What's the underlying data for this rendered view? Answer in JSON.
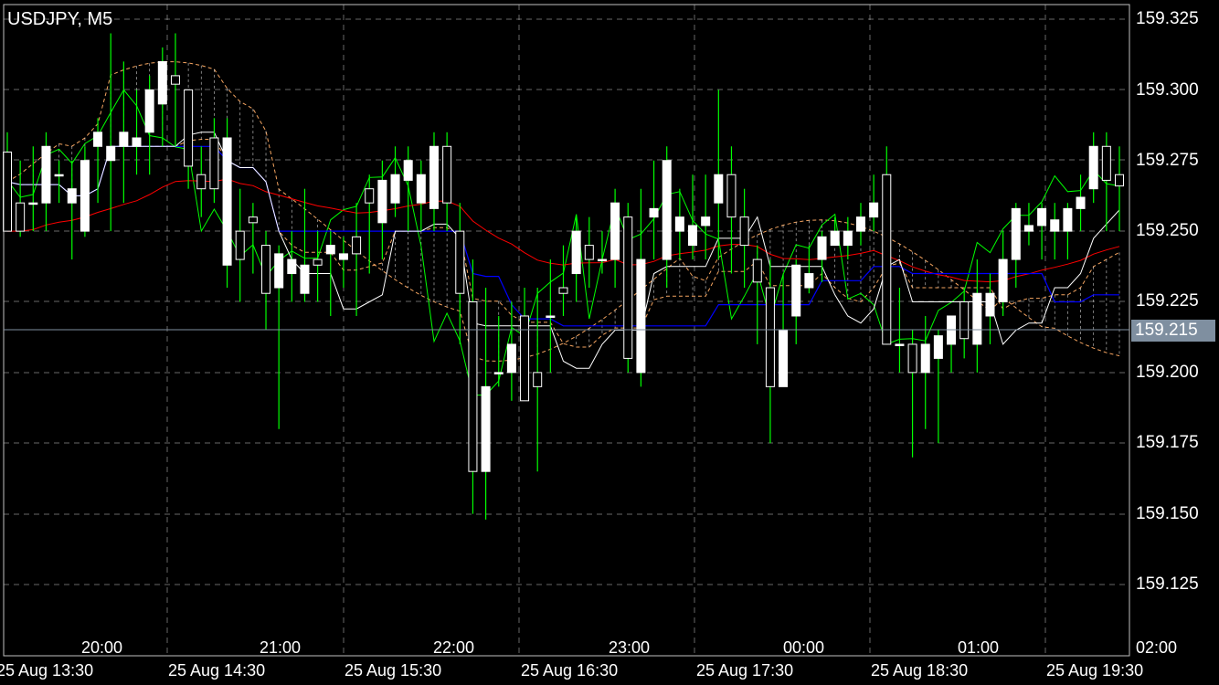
{
  "symbol_label": "USDJPY, M5",
  "current_price": "159.215",
  "price_axis": [
    "159.325",
    "159.300",
    "159.275",
    "159.250",
    "159.225",
    "159.200",
    "159.175",
    "159.150",
    "159.125"
  ],
  "time_labels": [
    "20:00",
    "21:00",
    "22:00",
    "23:00",
    "00:00",
    "01:00",
    "02:00"
  ],
  "date_labels": [
    "25 Aug 13:30",
    "25 Aug 14:30",
    "25 Aug 15:30",
    "25 Aug 16:30",
    "25 Aug 17:30",
    "25 Aug 18:30",
    "25 Aug 19:30"
  ],
  "colors": {
    "background": "#000000",
    "grid": "#c0c0c0",
    "bull_candle": "#ffffff",
    "bear_candle": "#000000",
    "wick": "#00ff00",
    "blue_line": "#0000ff",
    "red_line": "#ff0000",
    "green_line": "#00ff00",
    "white_line": "#ffffff",
    "cloud": "#f4a460",
    "price_tag": "#7f8fa0"
  },
  "chart_data": {
    "type": "candlestick",
    "ylim": [
      159.1,
      159.33
    ],
    "candles": [
      [
        159.278,
        159.285,
        159.25,
        159.25
      ],
      [
        159.26,
        159.275,
        159.248,
        159.25
      ],
      [
        159.26,
        159.28,
        159.25,
        159.26
      ],
      [
        159.26,
        159.285,
        159.25,
        159.28
      ],
      [
        159.27,
        159.275,
        159.26,
        159.27
      ],
      [
        159.26,
        159.275,
        159.24,
        159.265
      ],
      [
        159.25,
        159.28,
        159.248,
        159.275
      ],
      [
        159.28,
        159.29,
        159.26,
        159.285
      ],
      [
        159.275,
        159.32,
        159.25,
        159.28
      ],
      [
        159.28,
        159.31,
        159.26,
        159.285
      ],
      [
        159.28,
        159.3,
        159.27,
        159.283
      ],
      [
        159.285,
        159.305,
        159.27,
        159.3
      ],
      [
        159.295,
        159.315,
        159.28,
        159.31
      ],
      [
        159.305,
        159.32,
        159.28,
        159.302
      ],
      [
        159.3,
        159.3,
        159.265,
        159.273
      ],
      [
        159.27,
        159.28,
        159.255,
        159.265
      ],
      [
        159.283,
        159.29,
        159.26,
        159.265
      ],
      [
        159.238,
        159.29,
        159.23,
        159.283
      ],
      [
        159.25,
        159.265,
        159.225,
        159.24
      ],
      [
        159.255,
        159.26,
        159.235,
        159.253
      ],
      [
        159.245,
        159.25,
        159.215,
        159.228
      ],
      [
        159.23,
        159.245,
        159.18,
        159.242
      ],
      [
        159.235,
        159.25,
        159.225,
        159.24
      ],
      [
        159.228,
        159.265,
        159.225,
        159.238
      ],
      [
        159.24,
        159.25,
        159.225,
        159.238
      ],
      [
        159.242,
        159.25,
        159.22,
        159.245
      ],
      [
        159.24,
        159.248,
        159.23,
        159.242
      ],
      [
        159.248,
        159.26,
        159.22,
        159.242
      ],
      [
        159.265,
        159.27,
        159.235,
        159.26
      ],
      [
        159.253,
        159.275,
        159.24,
        159.268
      ],
      [
        159.26,
        159.28,
        159.255,
        159.27
      ],
      [
        159.268,
        159.28,
        159.25,
        159.275
      ],
      [
        159.26,
        159.275,
        159.25,
        159.27
      ],
      [
        159.258,
        159.285,
        159.25,
        159.28
      ],
      [
        159.28,
        159.285,
        159.25,
        159.26
      ],
      [
        159.25,
        159.26,
        159.21,
        159.228
      ],
      [
        159.225,
        159.24,
        159.15,
        159.165
      ],
      [
        159.165,
        159.23,
        159.148,
        159.195
      ],
      [
        159.2,
        159.22,
        159.195,
        159.2
      ],
      [
        159.2,
        159.225,
        159.19,
        159.21
      ],
      [
        159.22,
        159.23,
        159.19,
        159.19
      ],
      [
        159.2,
        159.23,
        159.165,
        159.195
      ],
      [
        159.22,
        159.24,
        159.2,
        159.22
      ],
      [
        159.23,
        159.245,
        159.22,
        159.228
      ],
      [
        159.235,
        159.255,
        159.225,
        159.25
      ],
      [
        159.245,
        159.255,
        159.23,
        159.24
      ],
      [
        159.24,
        159.25,
        159.235,
        159.24
      ],
      [
        159.24,
        159.265,
        159.23,
        159.26
      ],
      [
        159.255,
        159.26,
        159.2,
        159.205
      ],
      [
        159.2,
        159.265,
        159.195,
        159.24
      ],
      [
        159.255,
        159.275,
        159.24,
        159.258
      ],
      [
        159.24,
        159.28,
        159.23,
        159.275
      ],
      [
        159.25,
        159.265,
        159.24,
        159.255
      ],
      [
        159.245,
        159.27,
        159.24,
        159.252
      ],
      [
        159.252,
        159.27,
        159.24,
        159.255
      ],
      [
        159.26,
        159.3,
        159.24,
        159.27
      ],
      [
        159.27,
        159.28,
        159.235,
        159.255
      ],
      [
        159.255,
        159.265,
        159.23,
        159.245
      ],
      [
        159.24,
        159.245,
        159.21,
        159.232
      ],
      [
        159.23,
        159.24,
        159.175,
        159.195
      ],
      [
        159.195,
        159.235,
        159.195,
        159.215
      ],
      [
        159.22,
        159.24,
        159.21,
        159.238
      ],
      [
        159.23,
        159.245,
        159.228,
        159.235
      ],
      [
        159.24,
        159.25,
        159.232,
        159.248
      ],
      [
        159.245,
        159.255,
        159.245,
        159.25
      ],
      [
        159.245,
        159.255,
        159.24,
        159.25
      ],
      [
        159.25,
        159.26,
        159.245,
        159.255
      ],
      [
        159.255,
        159.27,
        159.25,
        159.26
      ],
      [
        159.27,
        159.28,
        159.215,
        159.21
      ],
      [
        159.21,
        159.23,
        159.2,
        159.21
      ],
      [
        159.21,
        159.215,
        159.17,
        159.2
      ],
      [
        159.2,
        159.22,
        159.18,
        159.21
      ],
      [
        159.205,
        159.215,
        159.175,
        159.213
      ],
      [
        159.21,
        159.22,
        159.2,
        159.22
      ],
      [
        159.225,
        159.23,
        159.205,
        159.212
      ],
      [
        159.21,
        159.24,
        159.2,
        159.228
      ],
      [
        159.22,
        159.235,
        159.21,
        159.228
      ],
      [
        159.225,
        159.25,
        159.22,
        159.24
      ],
      [
        159.24,
        159.26,
        159.23,
        159.258
      ],
      [
        159.25,
        159.26,
        159.245,
        159.252
      ],
      [
        159.252,
        159.26,
        159.24,
        159.258
      ],
      [
        159.25,
        159.26,
        159.24,
        159.254
      ],
      [
        159.25,
        159.26,
        159.24,
        159.258
      ],
      [
        159.258,
        159.27,
        159.25,
        159.262
      ],
      [
        159.265,
        159.285,
        159.26,
        159.28
      ],
      [
        159.28,
        159.285,
        159.25,
        159.268
      ],
      [
        159.27,
        159.28,
        159.25,
        159.266
      ]
    ]
  }
}
